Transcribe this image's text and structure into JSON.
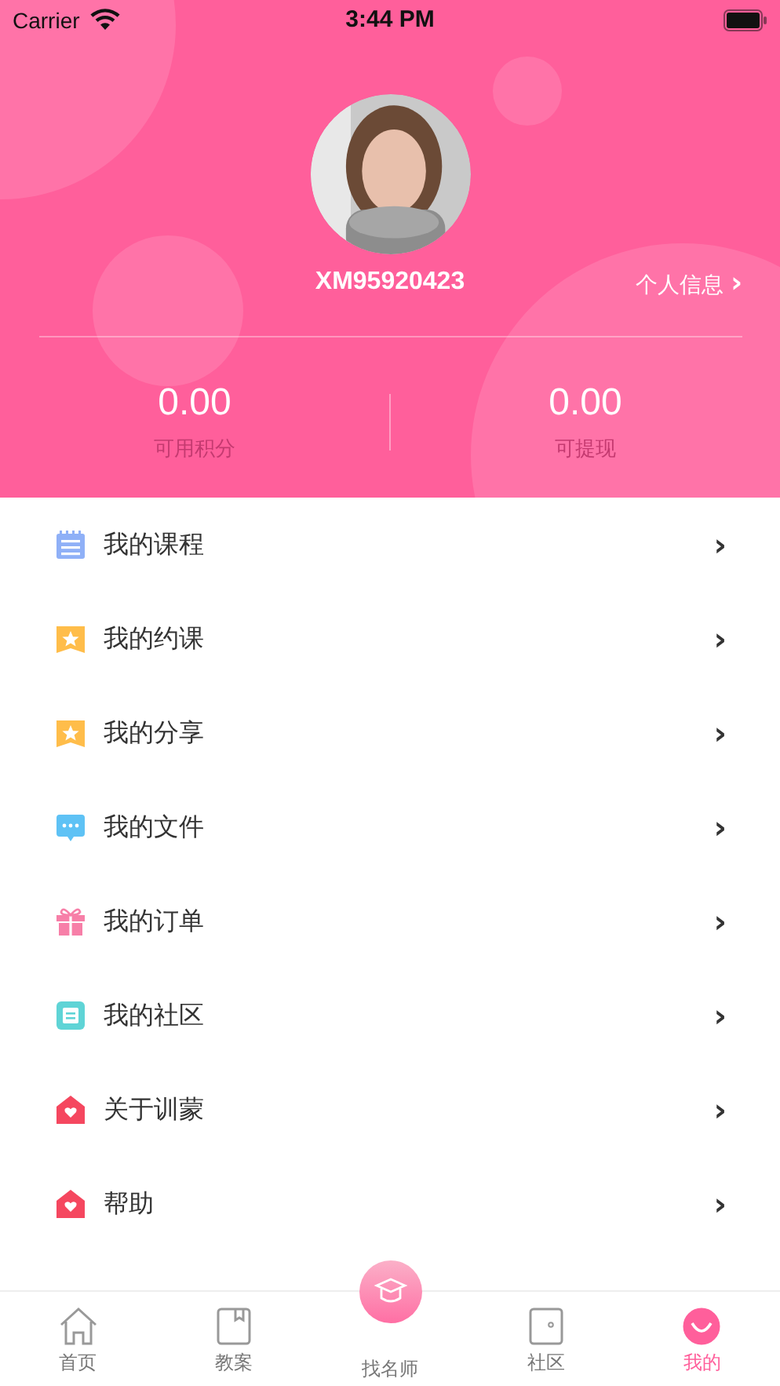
{
  "status_bar": {
    "carrier": "Carrier",
    "time": "3:44 PM"
  },
  "profile": {
    "username": "XM95920423",
    "info_link": "个人信息",
    "info_chevron": "›"
  },
  "stats": [
    {
      "value": "0.00",
      "label": "可用积分"
    },
    {
      "value": "0.00",
      "label": "可提现"
    }
  ],
  "menu": [
    {
      "kind": "list",
      "color": "#8fb0f7",
      "label": "我的课程",
      "chevron": "›"
    },
    {
      "kind": "star",
      "color": "#ffbd4a",
      "label": "我的约课",
      "chevron": "›"
    },
    {
      "kind": "star",
      "color": "#ffbd4a",
      "label": "我的分享",
      "chevron": "›"
    },
    {
      "kind": "chat",
      "color": "#5ec2f5",
      "label": "我的文件",
      "chevron": "›"
    },
    {
      "kind": "gift",
      "color": "#f77fa8",
      "label": "我的订单",
      "chevron": "›"
    },
    {
      "kind": "note",
      "color": "#5fd4d6",
      "label": "我的社区",
      "chevron": "›"
    },
    {
      "kind": "house",
      "color": "#f5475f",
      "label": "关于训蒙",
      "chevron": "›"
    },
    {
      "kind": "house",
      "color": "#f5475f",
      "label": "帮助",
      "chevron": "›"
    }
  ],
  "tab_bar": [
    {
      "kind": "home",
      "label": "首页",
      "selected": false
    },
    {
      "kind": "book",
      "label": "教案",
      "selected": false
    },
    {
      "kind": "center",
      "label": "找名师",
      "selected": false
    },
    {
      "kind": "door",
      "label": "社区",
      "selected": false
    },
    {
      "kind": "smile",
      "label": "我的",
      "selected": true
    }
  ]
}
